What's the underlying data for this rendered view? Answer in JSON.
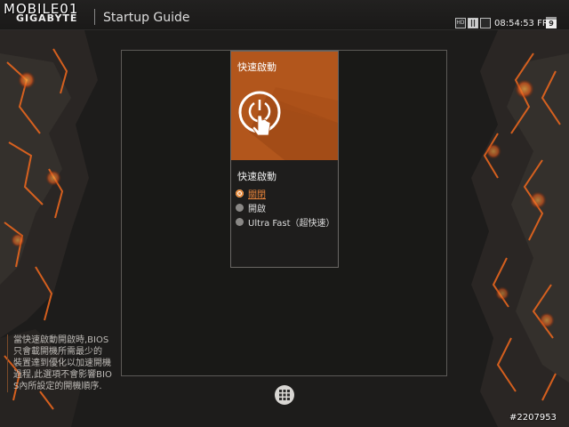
{
  "watermark": "MOBILE01",
  "header": {
    "brand": "GIGABYTE",
    "title": "Startup Guide"
  },
  "tray": {
    "hd_label": "HD",
    "clock": "08:54:53 FRI",
    "calendar_day": "9"
  },
  "panel": {
    "hero_title": "快速啟動",
    "heading": "快速啟動",
    "options": [
      {
        "label": "關閉",
        "selected": true
      },
      {
        "label": "開啟",
        "selected": false
      },
      {
        "label": "Ultra Fast（超快速）",
        "selected": false
      }
    ]
  },
  "help": {
    "lines": [
      "當快速啟動開啟時,BIOS",
      "只會載開機所需最少的",
      "裝置達到優化以加速開機",
      "過程,此選項不會影響BIO",
      "S內所設定的開機順序."
    ]
  },
  "photo_id": "#2207953",
  "colors": {
    "accent": "#b2561c",
    "selected": "#e8843a",
    "background": "#1b1a19"
  }
}
